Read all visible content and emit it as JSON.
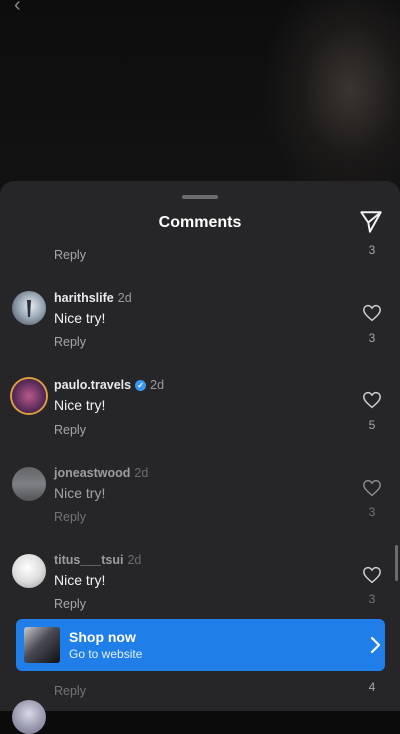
{
  "sheet": {
    "title": "Comments"
  },
  "top_reply": {
    "reply_label": "Reply",
    "like_count": "3"
  },
  "comments": [
    {
      "username": "harithslife",
      "age": "2d",
      "text": "Nice try!",
      "reply_label": "Reply",
      "like_count": "3",
      "verified": false
    },
    {
      "username": "paulo.travels",
      "age": "2d",
      "text": "Nice try!",
      "reply_label": "Reply",
      "like_count": "5",
      "verified": true
    },
    {
      "username": "joneastwood",
      "age": "2d",
      "text": "Nice try!",
      "reply_label": "Reply",
      "like_count": "3",
      "verified": false
    },
    {
      "username": "titus___tsui",
      "age": "2d",
      "text": "Nice try!",
      "reply_label": "Reply",
      "like_count": "3",
      "verified": false
    }
  ],
  "partial_row": {
    "reply_label": "Reply",
    "like_count": "4"
  },
  "shop_banner": {
    "title": "Shop now",
    "subtitle": "Go to website"
  },
  "colors": {
    "sheet_bg": "#262629",
    "banner_accent": "#1f7ee8",
    "verified_badge": "#3897f0"
  }
}
